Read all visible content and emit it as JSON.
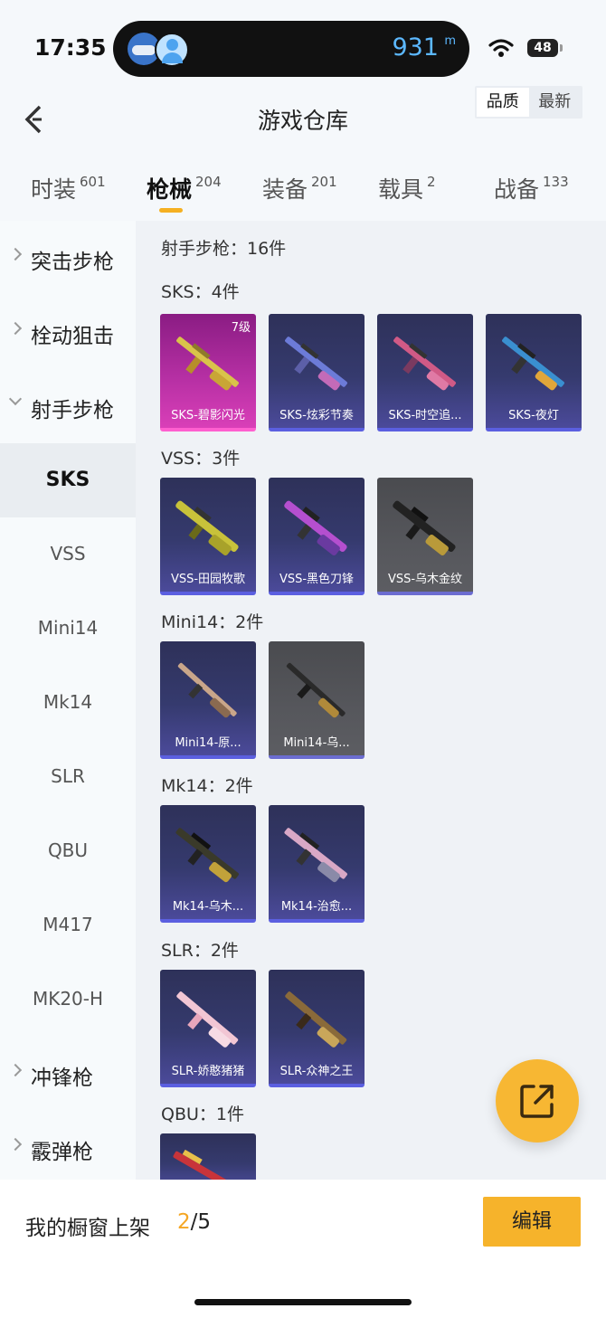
{
  "status": {
    "time": "17:35",
    "island_value": "931",
    "island_unit": "m",
    "battery": "48"
  },
  "header": {
    "title": "游戏仓库",
    "sort_options": [
      "品质",
      "最新"
    ]
  },
  "tabs": [
    {
      "label": "时装",
      "count": "601"
    },
    {
      "label": "枪械",
      "count": "204"
    },
    {
      "label": "装备",
      "count": "201"
    },
    {
      "label": "载具",
      "count": "2"
    },
    {
      "label": "战备",
      "count": "133"
    }
  ],
  "sidebar": {
    "groups": [
      "突击步枪",
      "栓动狙击",
      "射手步枪",
      "冲锋枪",
      "霰弹枪"
    ],
    "subs": [
      "SKS",
      "VSS",
      "Mini14",
      "Mk14",
      "SLR",
      "QBU",
      "M417",
      "MK20-H"
    ]
  },
  "content": {
    "category_total": "射手步枪：16件",
    "sections": [
      {
        "title": "SKS：4件",
        "items": [
          "SKS-碧影闪光",
          "SKS-炫彩节奏",
          "SKS-时空追...",
          "SKS-夜灯"
        ],
        "level": "7级"
      },
      {
        "title": "VSS：3件",
        "items": [
          "VSS-田园牧歌",
          "VSS-黑色刀锋",
          "VSS-乌木金纹"
        ]
      },
      {
        "title": "Mini14：2件",
        "items": [
          "Mini14-原...",
          "Mini14-乌..."
        ]
      },
      {
        "title": "Mk14：2件",
        "items": [
          "Mk14-乌木...",
          "Mk14-治愈..."
        ]
      },
      {
        "title": "SLR：2件",
        "items": [
          "SLR-娇憨猪猪",
          "SLR-众神之王"
        ]
      },
      {
        "title": "QBU：1件",
        "items": []
      }
    ]
  },
  "bottom": {
    "shelf_label": "我的橱窗上架",
    "current": "2",
    "total": "/5",
    "edit": "编辑"
  },
  "colors": {
    "accent": "#f6b32b",
    "card_blue": "#353a6e",
    "card_legend": "#b52fa3"
  },
  "icons": [
    "back-arrow-icon",
    "wifi-icon",
    "share-icon",
    "chevron-right-icon",
    "chevron-down-icon"
  ]
}
